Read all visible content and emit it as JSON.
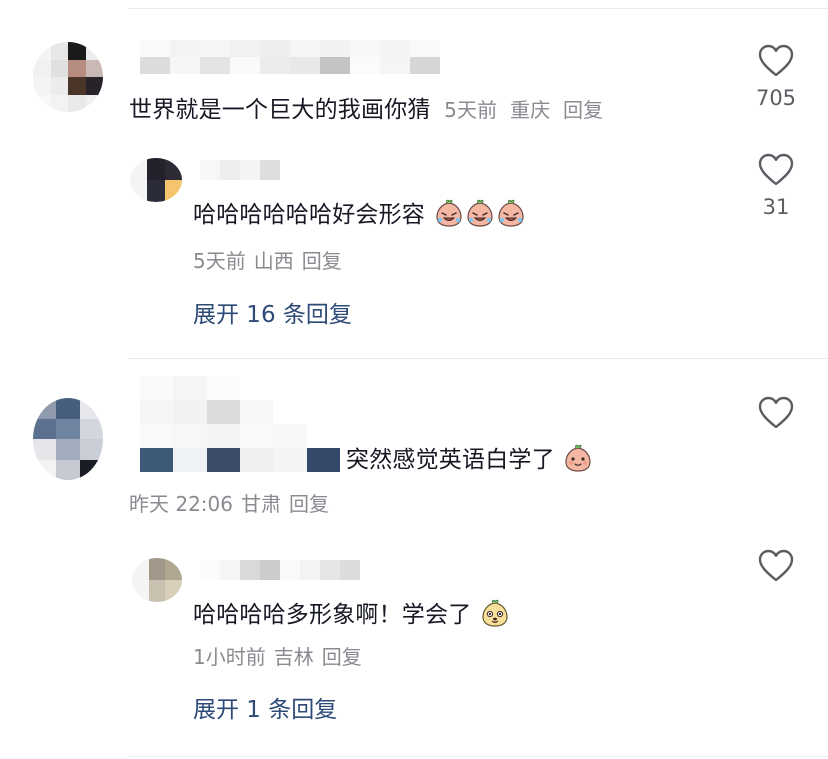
{
  "comments": [
    {
      "text": "世界就是一个巨大的我画你猜",
      "time": "5天前",
      "location": "重庆",
      "reply_label": "回复",
      "likes": "705",
      "replies": [
        {
          "text": "哈哈哈哈哈哈好会形容",
          "emoji": [
            "crying-laughing-peach-emoji",
            "crying-laughing-peach-emoji",
            "crying-laughing-peach-emoji"
          ],
          "time": "5天前",
          "location": "山西",
          "reply_label": "回复",
          "likes": "31"
        }
      ],
      "expand_label": "展开 16 条回复"
    },
    {
      "text": "突然感觉英语白学了",
      "emoji": [
        "smiling-peach-emoji"
      ],
      "time": "昨天 22:06",
      "location": "甘肃",
      "reply_label": "回复",
      "likes": "",
      "replies": [
        {
          "text": "哈哈哈哈多形象啊！学会了",
          "emoji": [
            "dog-face-emoji"
          ],
          "time": "1小时前",
          "location": "吉林",
          "reply_label": "回复",
          "likes": ""
        }
      ],
      "expand_label": "展开 1 条回复"
    }
  ],
  "colors": {
    "text": "#161823",
    "meta": "#8a8b91",
    "link": "#2e4a77",
    "divider": "#ececee"
  }
}
